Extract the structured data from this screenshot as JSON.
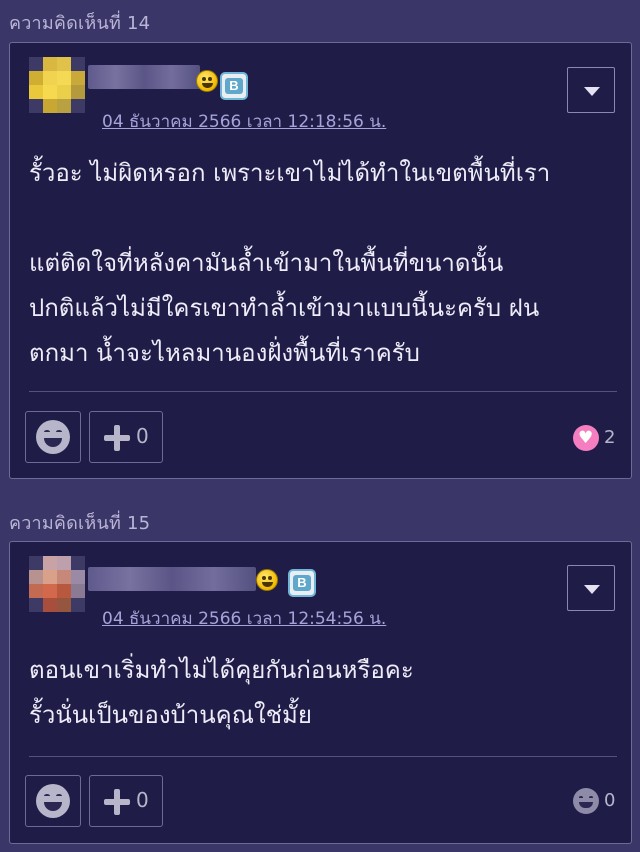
{
  "comments": [
    {
      "header": "ความคิดเห็นที่ 14",
      "timestamp": "04 ธันวาคม 2566 เวลา 12:18:56 น.",
      "body": "รั้วอะ ไม่ผิดหรอก เพราะเขาไม่ได้ทำในเขตพื้นที่เรา\n\nแต่ติดใจที่หลังคามันล้ำเข้ามาในพื้นที่ขนาดนั้น\nปกติแล้วไม่มีใครเขาทำล้ำเข้ามาแบบนี้นะครับ ฝน\nตกมา น้ำจะไหลมานองฝั่งพื้นที่เราครับ",
      "plus_count": "0",
      "reaction_icon": "heart-bubble-icon",
      "reaction_count": "2"
    },
    {
      "header": "ความคิดเห็นที่ 15",
      "timestamp": "04 ธันวาคม 2566 เวลา 12:54:56 น.",
      "body": "ตอนเขาเริ่มทำไม่ได้คุยกันก่อนหรือคะ\nรั้วนั่นเป็นของบ้านคุณใช่มั้ย",
      "plus_count": "0",
      "reaction_icon": "smile-icon",
      "reaction_count": "0"
    }
  ],
  "colors": {
    "page_bg": "#3b3668",
    "card_bg": "#1f1d47",
    "border": "#6e6a98",
    "timestamp": "#a7a2d8",
    "heart": "#f47ec0"
  }
}
